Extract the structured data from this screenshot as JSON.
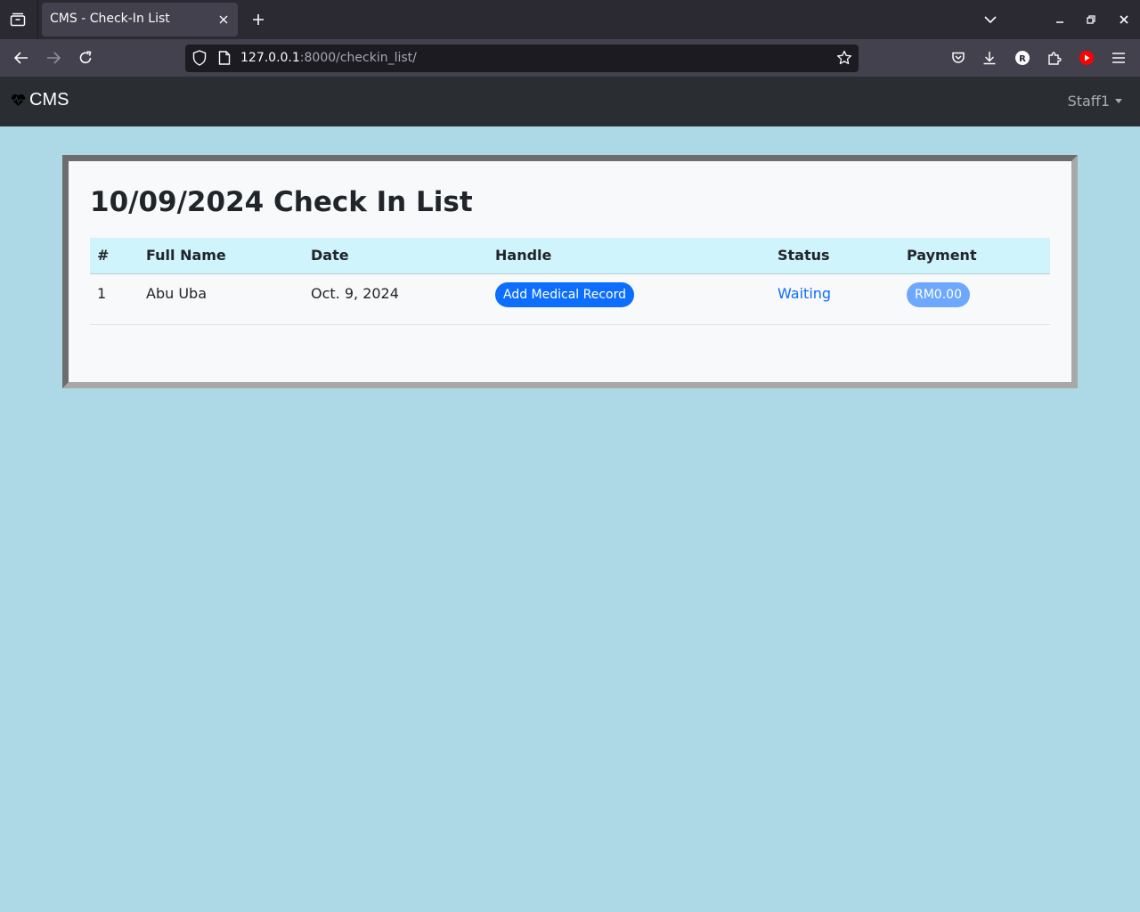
{
  "browser": {
    "tab_title": "CMS - Check-In List",
    "url_host": "127.0.0.1",
    "url_path": ":8000/checkin_list/"
  },
  "app": {
    "brand": "CMS",
    "user": "Staff1"
  },
  "page": {
    "title": "10/09/2024 Check In List"
  },
  "table": {
    "headers": [
      "#",
      "Full Name",
      "Date",
      "Handle",
      "Status",
      "Payment"
    ],
    "rows": [
      {
        "num": "1",
        "full_name": "Abu Uba",
        "date": "Oct. 9, 2024",
        "handle_label": "Add Medical Record",
        "status": "Waiting",
        "payment": "RM0.00"
      }
    ]
  },
  "colors": {
    "page_bg": "#add8e6",
    "navbar_bg": "#2a2e33",
    "primary": "#0d6efd",
    "table_header_bg": "#cff4fc"
  }
}
